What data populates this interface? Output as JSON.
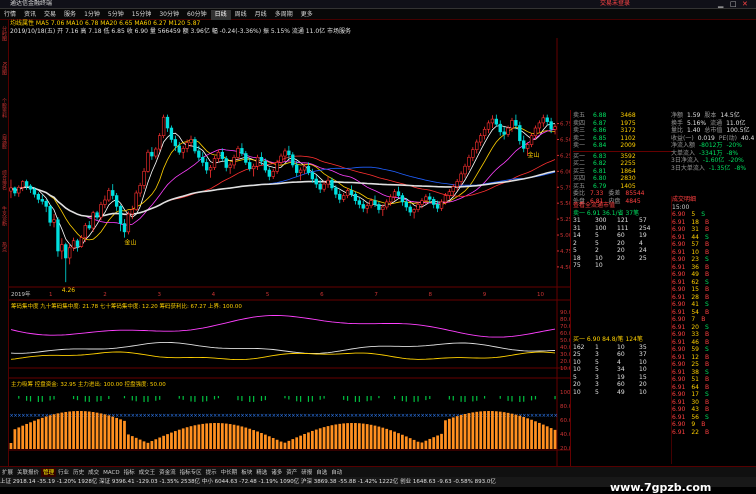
{
  "window": {
    "title": "通达信金融终端",
    "right_label": "交易未登录"
  },
  "menu": [
    "行情",
    "资讯",
    "交易",
    "服务",
    "1分钟",
    "5分钟",
    "15分钟",
    "30分钟",
    "60分钟",
    "日线",
    "周线",
    "月线",
    "多周期",
    "更多"
  ],
  "menu_active": "日线",
  "info": {
    "line1": "均线属性  MA5 7.06  MA10 6.78  MA20 6.65  MA60 6.27  M120 5.87",
    "line2": "2019/10/18(五) 开 7.16  高 7.18  低 6.85  收 6.90  量 566459  额 3.96亿  幅 -0.24(-3.36%)  振 5.15%  流通 11.0亿  市场服务"
  },
  "sidebar_labels": [
    "分时图",
    "K线图",
    "个股资料",
    "自选股",
    "综合排名",
    "牛叉诊断",
    "热点"
  ],
  "indicator1": {
    "title": "筹码集中度  九十筹码集中度: 21.78  七十筹码集中度: 12.20  筹码获利比: 67.27  上界: 100.00"
  },
  "indicator2": {
    "title": "主力吸筹  控盘资金: 32.95  主力进出: 100.00  控盘强度: 50.00"
  },
  "order_book": {
    "sells": [
      [
        "卖五",
        "6.88",
        "3468"
      ],
      [
        "卖四",
        "6.87",
        "1975"
      ],
      [
        "卖三",
        "6.86",
        "3172"
      ],
      [
        "卖二",
        "6.85",
        "1102"
      ],
      [
        "卖一",
        "6.84",
        "2009"
      ]
    ],
    "buys": [
      [
        "买一",
        "6.83",
        "3592"
      ],
      [
        "买二",
        "6.82",
        "2255"
      ],
      [
        "买三",
        "6.81",
        "1864"
      ],
      [
        "买四",
        "6.80",
        "2830"
      ],
      [
        "买五",
        "6.79",
        "1405"
      ]
    ],
    "summary": [
      [
        "委比",
        "7.33",
        "委差",
        "85544"
      ],
      [
        "外盘",
        "6.81",
        "内盘",
        "4845"
      ]
    ]
  },
  "stats": [
    [
      "净额",
      "1.59",
      "股本",
      "14.5亿"
    ],
    [
      "换手",
      "5.16%",
      "流通",
      "11.0亿"
    ],
    [
      "量比",
      "1.40",
      "总市值",
      "100.5亿"
    ],
    [
      "收益(一)",
      "0.019",
      "PE(动)",
      "40.4"
    ]
  ],
  "flows": [
    [
      "净流入额",
      "-8012万"
    ],
    [
      "大单流入",
      "-3341万"
    ],
    [
      "3日净流入",
      "-1.60亿"
    ],
    [
      "3日大单流入",
      "-1.35亿"
    ]
  ],
  "flow_pct": [
    "-20%",
    "-8%",
    "-20%",
    "-8%"
  ],
  "chip_panel": {
    "title": "查看全流通市值",
    "row": [
      "卖一",
      "6.91",
      "36.1/省",
      "37笔"
    ]
  },
  "ticks_left": [
    [
      "31",
      "300",
      "121",
      "57"
    ],
    [
      "31",
      "100",
      "111",
      "254"
    ],
    [
      "14",
      "5",
      "60",
      "19"
    ],
    [
      "2",
      "5",
      "20",
      "4"
    ],
    [
      "5",
      "2",
      "20",
      "24"
    ],
    [
      "18",
      "10",
      "20",
      "25"
    ],
    [
      "75",
      "10",
      "",
      ""
    ]
  ],
  "ticks_left2": [
    [
      "162",
      "1",
      "10",
      "35"
    ],
    [
      "25",
      "3",
      "60",
      "37"
    ],
    [
      "10",
      "5",
      "4",
      "10"
    ],
    [
      "10",
      "5",
      "34",
      "10"
    ],
    [
      "5",
      "3",
      "19",
      "15"
    ],
    [
      "20",
      "3",
      "60",
      "20"
    ],
    [
      "10",
      "5",
      "49",
      "10"
    ]
  ],
  "buy_panel": {
    "row": [
      "买一",
      "6.90",
      "84.8/笔",
      "124笔"
    ]
  },
  "trade_list": {
    "title": "成交明细",
    "time": "15:00"
  },
  "bottom_tabs": [
    "扩展",
    "关联报价",
    "管理",
    "行业",
    "历史",
    "成交",
    "MACD",
    "指标",
    "成交王",
    "资金流",
    "指标专区",
    "提示",
    "中长期",
    "板块",
    "精选",
    "诸多",
    "资产",
    "研报",
    "自选",
    "自动"
  ],
  "bottom_active": "管理",
  "status": "上证 2918.14  -35.19  -1.20%  1928亿    深证 9396.41  -129.03  -1.35%  2538亿    中小 6044.63  -72.48  -1.19%  1090亿    沪深 3869.38  -55.88  -1.42%  1222亿    创业 1648.63  -9.63  -0.58%  893.0亿",
  "watermark": "www.7gpzb.com",
  "chart_data": {
    "type": "candlestick",
    "price_axis": [
      "6.75",
      "6.50",
      "6.25",
      "6.00",
      "5.75",
      "5.50",
      "5.25",
      "5.00",
      "4.75",
      "4.50"
    ],
    "ylim": [
      4.2,
      6.9
    ],
    "annotations": [
      {
        "text": "4.26",
        "index": 14
      },
      {
        "text": "金山",
        "index": 30
      },
      {
        "text": "金山",
        "index": 133
      }
    ],
    "ind1_axis": [
      "90.00",
      "80.00",
      "70.00",
      "60.00",
      "50.00",
      "40.00",
      "30.00",
      "20.00",
      "10.00"
    ],
    "ind2_axis": [
      "100.00",
      "80.00",
      "60.00",
      "40.00",
      "20.00"
    ],
    "date_label": "2019年",
    "dates_x": [
      "1",
      "2",
      "3",
      "4",
      "5",
      "6",
      "7",
      "8",
      "9",
      "10"
    ],
    "candles": [
      [
        5.69,
        5.87,
        5.58,
        5.74
      ],
      [
        5.74,
        5.76,
        5.61,
        5.66
      ],
      [
        5.66,
        5.78,
        5.6,
        5.75
      ],
      [
        5.75,
        5.86,
        5.69,
        5.84
      ],
      [
        5.84,
        5.87,
        5.71,
        5.77
      ],
      [
        5.77,
        5.8,
        5.66,
        5.72
      ],
      [
        5.72,
        5.75,
        5.59,
        5.64
      ],
      [
        5.64,
        5.67,
        5.5,
        5.56
      ],
      [
        5.56,
        5.63,
        5.48,
        5.53
      ],
      [
        5.53,
        5.56,
        5.36,
        5.45
      ],
      [
        5.45,
        5.48,
        5.14,
        5.2
      ],
      [
        5.2,
        5.33,
        5.12,
        5.24
      ],
      [
        5.24,
        5.28,
        4.66,
        4.75
      ],
      [
        4.75,
        4.95,
        4.62,
        4.85
      ],
      [
        4.85,
        4.88,
        4.26,
        4.64
      ],
      [
        4.64,
        4.87,
        4.54,
        4.8
      ],
      [
        4.8,
        4.96,
        4.75,
        4.91
      ],
      [
        4.91,
        4.94,
        4.74,
        4.82
      ],
      [
        4.82,
        5.0,
        4.8,
        4.96
      ],
      [
        4.96,
        5.19,
        4.89,
        5.15
      ],
      [
        5.15,
        5.22,
        5.08,
        5.11
      ],
      [
        5.11,
        5.38,
        5.05,
        5.35
      ],
      [
        5.35,
        5.38,
        5.24,
        5.28
      ],
      [
        5.28,
        5.52,
        5.23,
        5.48
      ],
      [
        5.48,
        5.62,
        5.42,
        5.55
      ],
      [
        5.55,
        5.74,
        5.52,
        5.7
      ],
      [
        5.7,
        5.8,
        5.56,
        5.62
      ],
      [
        5.62,
        5.66,
        5.38,
        5.45
      ],
      [
        5.45,
        5.48,
        5.06,
        5.18
      ],
      [
        5.18,
        5.25,
        4.96,
        5.05
      ],
      [
        5.05,
        5.37,
        5.01,
        5.33
      ],
      [
        5.33,
        5.46,
        5.25,
        5.4
      ],
      [
        5.4,
        5.7,
        5.38,
        5.66
      ],
      [
        5.66,
        5.82,
        5.6,
        5.78
      ],
      [
        5.78,
        6.05,
        5.72,
        6.0
      ],
      [
        6.0,
        6.34,
        5.98,
        6.3
      ],
      [
        6.3,
        6.38,
        6.18,
        6.24
      ],
      [
        6.24,
        6.38,
        6.2,
        6.35
      ],
      [
        6.35,
        6.6,
        6.31,
        6.56
      ],
      [
        6.56,
        6.89,
        6.52,
        6.85
      ],
      [
        6.85,
        6.89,
        6.62,
        6.68
      ],
      [
        6.68,
        6.72,
        6.45,
        6.5
      ],
      [
        6.5,
        6.56,
        6.32,
        6.4
      ],
      [
        6.4,
        6.46,
        6.26,
        6.3
      ],
      [
        6.3,
        6.4,
        6.2,
        6.36
      ],
      [
        6.36,
        6.5,
        6.3,
        6.45
      ],
      [
        6.45,
        6.56,
        6.38,
        6.5
      ],
      [
        6.5,
        6.54,
        6.28,
        6.32
      ],
      [
        6.32,
        6.4,
        6.16,
        6.22
      ],
      [
        6.22,
        6.3,
        6.08,
        6.14
      ],
      [
        6.14,
        6.2,
        5.96,
        6.02
      ],
      [
        6.02,
        6.1,
        5.9,
        6.06
      ],
      [
        6.06,
        6.24,
        6.02,
        6.2
      ],
      [
        6.2,
        6.34,
        6.14,
        6.3
      ],
      [
        6.3,
        6.36,
        6.16,
        6.2
      ],
      [
        6.2,
        6.24,
        6.0,
        6.06
      ],
      [
        6.06,
        6.14,
        5.96,
        6.1
      ],
      [
        6.1,
        6.26,
        6.04,
        6.22
      ],
      [
        6.22,
        6.4,
        6.18,
        6.36
      ],
      [
        6.36,
        6.44,
        6.24,
        6.28
      ],
      [
        6.28,
        6.32,
        6.1,
        6.14
      ],
      [
        6.14,
        6.2,
        6.0,
        6.04
      ],
      [
        6.04,
        6.12,
        5.92,
        6.08
      ],
      [
        6.08,
        6.26,
        6.02,
        6.22
      ],
      [
        6.22,
        6.3,
        6.1,
        6.16
      ],
      [
        6.16,
        6.2,
        5.98,
        6.02
      ],
      [
        6.02,
        6.06,
        5.86,
        5.92
      ],
      [
        5.92,
        6.04,
        5.88,
        6.0
      ],
      [
        6.0,
        6.18,
        5.96,
        6.14
      ],
      [
        6.14,
        6.28,
        6.1,
        6.24
      ],
      [
        6.24,
        6.36,
        6.16,
        6.32
      ],
      [
        6.32,
        6.4,
        6.2,
        6.26
      ],
      [
        6.26,
        6.3,
        6.06,
        6.1
      ],
      [
        6.1,
        6.16,
        5.92,
        5.98
      ],
      [
        5.98,
        6.06,
        5.86,
        6.02
      ],
      [
        6.02,
        6.12,
        5.96,
        6.08
      ],
      [
        6.08,
        6.14,
        5.94,
        5.98
      ],
      [
        5.98,
        6.04,
        5.82,
        5.88
      ],
      [
        5.88,
        5.94,
        5.74,
        5.8
      ],
      [
        5.8,
        5.86,
        5.66,
        5.72
      ],
      [
        5.72,
        5.84,
        5.68,
        5.8
      ],
      [
        5.8,
        5.92,
        5.74,
        5.86
      ],
      [
        5.86,
        5.9,
        5.7,
        5.74
      ],
      [
        5.74,
        5.78,
        5.58,
        5.64
      ],
      [
        5.64,
        5.7,
        5.5,
        5.56
      ],
      [
        5.56,
        5.66,
        5.52,
        5.62
      ],
      [
        5.62,
        5.74,
        5.58,
        5.7
      ],
      [
        5.7,
        5.78,
        5.6,
        5.64
      ],
      [
        5.64,
        5.68,
        5.48,
        5.54
      ],
      [
        5.54,
        5.6,
        5.42,
        5.48
      ],
      [
        5.48,
        5.54,
        5.36,
        5.42
      ],
      [
        5.42,
        5.5,
        5.34,
        5.46
      ],
      [
        5.46,
        5.58,
        5.42,
        5.54
      ],
      [
        5.54,
        5.62,
        5.44,
        5.48
      ],
      [
        5.48,
        5.52,
        5.34,
        5.4
      ],
      [
        5.4,
        5.48,
        5.3,
        5.44
      ],
      [
        5.44,
        5.56,
        5.4,
        5.52
      ],
      [
        5.52,
        5.64,
        5.46,
        5.6
      ],
      [
        5.6,
        5.72,
        5.54,
        5.68
      ],
      [
        5.68,
        5.76,
        5.58,
        5.62
      ],
      [
        5.62,
        5.66,
        5.46,
        5.52
      ],
      [
        5.52,
        5.58,
        5.38,
        5.44
      ],
      [
        5.44,
        5.48,
        5.3,
        5.36
      ],
      [
        5.36,
        5.42,
        5.26,
        5.4
      ],
      [
        5.4,
        5.52,
        5.36,
        5.48
      ],
      [
        5.48,
        5.58,
        5.42,
        5.54
      ],
      [
        5.54,
        5.64,
        5.48,
        5.6
      ],
      [
        5.6,
        5.66,
        5.5,
        5.56
      ],
      [
        5.56,
        5.6,
        5.42,
        5.48
      ],
      [
        5.48,
        5.54,
        5.36,
        5.42
      ],
      [
        5.42,
        5.56,
        5.38,
        5.52
      ],
      [
        5.52,
        5.66,
        5.48,
        5.62
      ],
      [
        5.62,
        5.72,
        5.56,
        5.68
      ],
      [
        5.68,
        5.8,
        5.62,
        5.76
      ],
      [
        5.76,
        5.88,
        5.7,
        5.84
      ],
      [
        5.84,
        6.0,
        5.78,
        5.96
      ],
      [
        5.96,
        6.12,
        5.9,
        6.08
      ],
      [
        6.08,
        6.26,
        6.02,
        6.22
      ],
      [
        6.22,
        6.38,
        6.16,
        6.34
      ],
      [
        6.34,
        6.5,
        6.28,
        6.46
      ],
      [
        6.46,
        6.6,
        6.4,
        6.56
      ],
      [
        6.56,
        6.7,
        6.5,
        6.66
      ],
      [
        6.66,
        6.8,
        6.6,
        6.76
      ],
      [
        6.76,
        6.88,
        6.68,
        6.82
      ],
      [
        6.82,
        6.89,
        6.7,
        6.74
      ],
      [
        6.74,
        6.8,
        6.56,
        6.62
      ],
      [
        6.62,
        6.7,
        6.5,
        6.58
      ],
      [
        6.58,
        6.72,
        6.54,
        6.68
      ],
      [
        6.68,
        6.84,
        6.62,
        6.8
      ],
      [
        6.8,
        6.89,
        6.66,
        6.72
      ],
      [
        6.72,
        6.78,
        6.42,
        6.48
      ],
      [
        6.48,
        6.56,
        6.3,
        6.36
      ],
      [
        6.36,
        6.46,
        6.24,
        6.42
      ],
      [
        6.42,
        6.6,
        6.38,
        6.56
      ],
      [
        6.56,
        6.72,
        6.5,
        6.68
      ],
      [
        6.68,
        6.8,
        6.6,
        6.76
      ],
      [
        6.76,
        6.89,
        6.7,
        6.84
      ],
      [
        6.84,
        6.89,
        6.72,
        6.78
      ],
      [
        6.78,
        6.84,
        6.6,
        6.66
      ],
      [
        6.66,
        6.74,
        6.58,
        6.7
      ]
    ]
  }
}
